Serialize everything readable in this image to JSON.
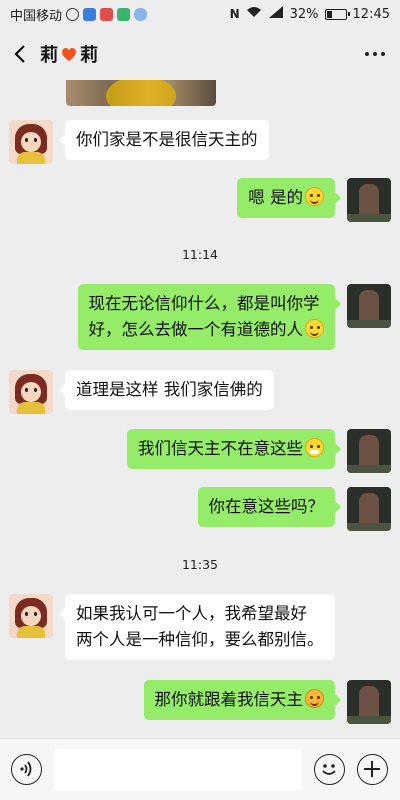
{
  "status_bar": {
    "carrier": "中国移动",
    "battery": "32%",
    "battery_level": 0.32,
    "time": "12:45"
  },
  "header": {
    "title_left": "莉",
    "title_right": "莉",
    "title_icon": "heart-icon"
  },
  "messages": [
    {
      "from": "contact",
      "text": "你们家是不是很信天主的"
    },
    {
      "from": "me",
      "text": "嗯 是的",
      "emoji": "smile"
    },
    {
      "time": "11:14"
    },
    {
      "from": "me",
      "lines": [
        "现在无论信仰什么，都是叫你学",
        "好，怎么去做一个有道德的人"
      ],
      "emoji": "smile"
    },
    {
      "from": "contact",
      "text": "道理是这样 我们家信佛的"
    },
    {
      "from": "me",
      "text": "我们信天主不在意这些",
      "emoji": "grin"
    },
    {
      "from": "me",
      "text": "你在意这些吗？"
    },
    {
      "time": "11:35"
    },
    {
      "from": "contact",
      "lines": [
        "如果我认可一个人，我希望最好",
        "两个人是一种信仰，要么都别信。"
      ]
    },
    {
      "from": "me",
      "text": "那你就跟着我信天主",
      "emoji": "blush"
    }
  ],
  "input_bar": {
    "left_icon": "voice-icon",
    "right_icons": [
      "emoji-icon",
      "plus-icon"
    ]
  }
}
